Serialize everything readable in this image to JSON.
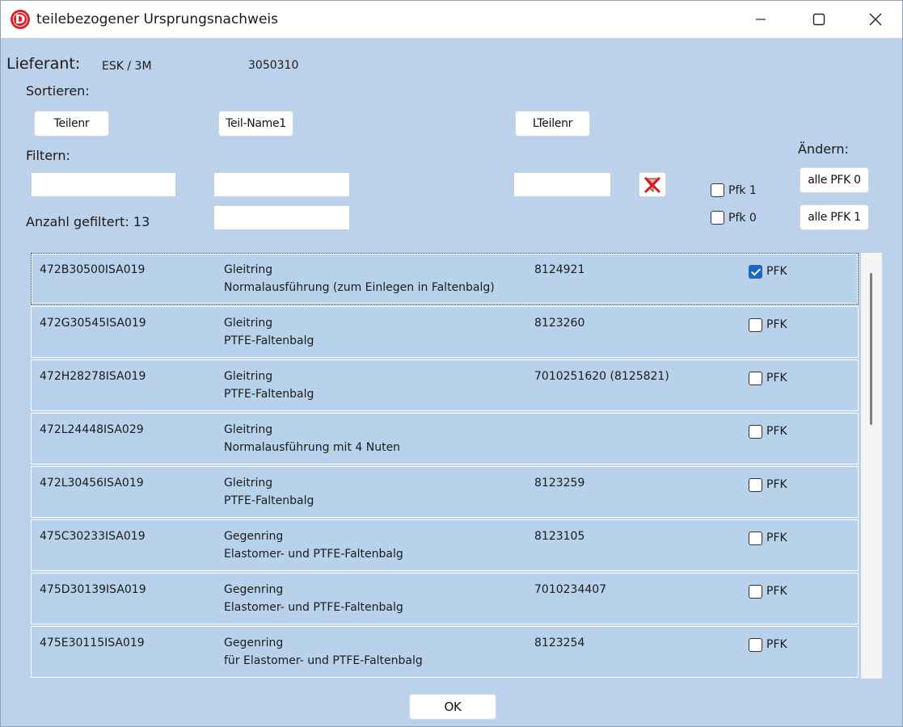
{
  "window": {
    "title": "teilebezogener Ursprungsnachweis",
    "app_icon_letter": "D"
  },
  "supplier": {
    "label": "Lieferant:",
    "name": "ESK / 3M",
    "number": "3050310"
  },
  "sort": {
    "label": "Sortieren:",
    "buttons": [
      "Teilenr",
      "Teil-Name1",
      "LTeilenr"
    ]
  },
  "filter": {
    "label": "Filtern:",
    "count_label": "Anzahl gefiltert: 13",
    "pfk1_label": "Pfk 1",
    "pfk0_label": "Pfk 0",
    "pfk1_checked": false,
    "pfk0_checked": false
  },
  "change": {
    "label": "Ändern:",
    "all_pfk0": "alle PFK 0",
    "all_pfk1": "alle PFK 1"
  },
  "rows": [
    {
      "teilenr": "472B30500ISA019",
      "name1": "Gleitring",
      "name2": "Normalausführung (zum Einlegen in Faltenbalg)",
      "lteilenr": "8124921",
      "pfk": true
    },
    {
      "teilenr": "472G30545ISA019",
      "name1": "Gleitring",
      "name2": "PTFE-Faltenbalg",
      "lteilenr": "8123260",
      "pfk": false
    },
    {
      "teilenr": "472H28278ISA019",
      "name1": "Gleitring",
      "name2": "PTFE-Faltenbalg",
      "lteilenr": "7010251620 (8125821)",
      "pfk": false
    },
    {
      "teilenr": "472L24448ISA029",
      "name1": "Gleitring",
      "name2": "Normalausführung mit 4 Nuten",
      "lteilenr": "",
      "pfk": false
    },
    {
      "teilenr": "472L30456ISA019",
      "name1": "Gleitring",
      "name2": "PTFE-Faltenbalg",
      "lteilenr": "8123259",
      "pfk": false
    },
    {
      "teilenr": "475C30233ISA019",
      "name1": "Gegenring",
      "name2": "Elastomer- und PTFE-Faltenbalg",
      "lteilenr": "8123105",
      "pfk": false
    },
    {
      "teilenr": "475D30139ISA019",
      "name1": "Gegenring",
      "name2": "Elastomer- und PTFE-Faltenbalg",
      "lteilenr": "7010234407",
      "pfk": false
    },
    {
      "teilenr": "475E30115ISA019",
      "name1": "Gegenring",
      "name2": "für Elastomer- und PTFE-Faltenbalg",
      "lteilenr": "8123254",
      "pfk": false
    }
  ],
  "pfk_label": "PFK",
  "ok_label": "OK"
}
